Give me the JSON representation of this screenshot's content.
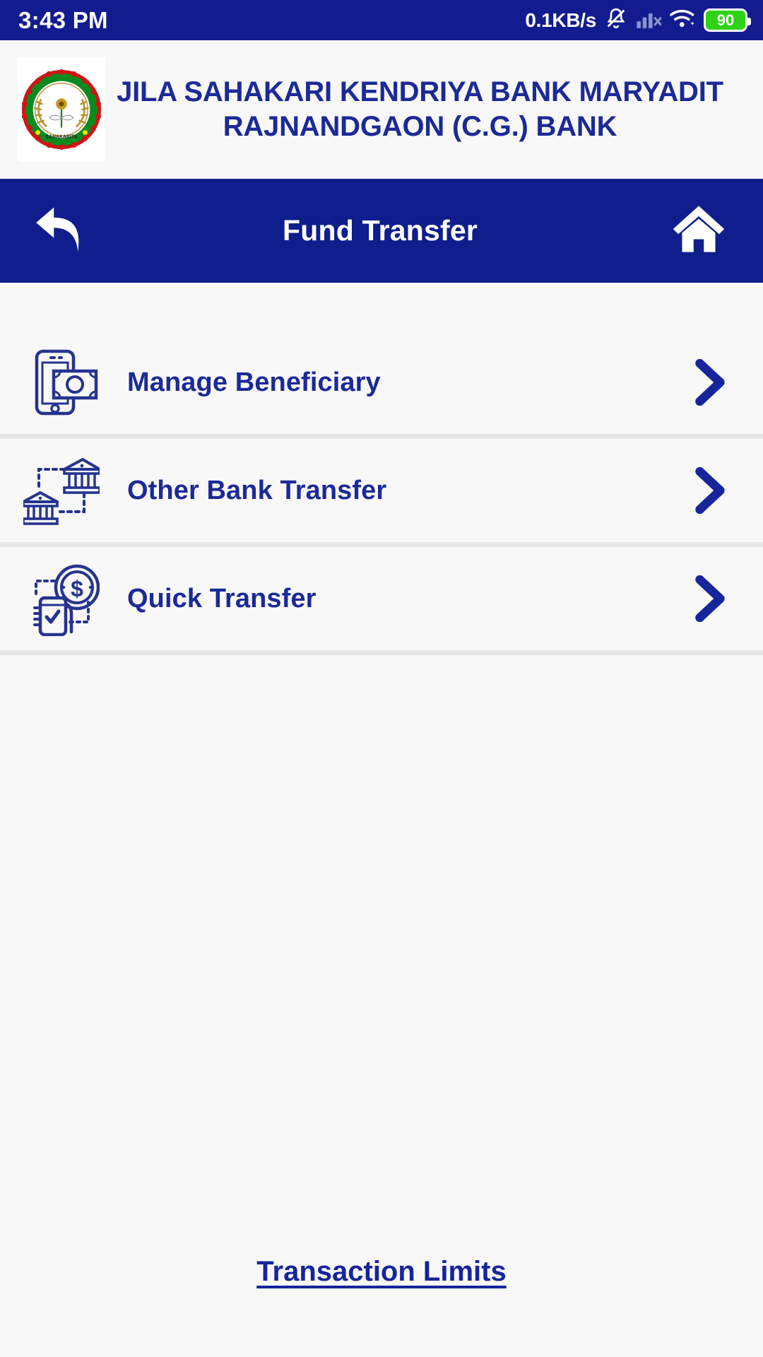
{
  "status_bar": {
    "time": "3:43 PM",
    "network_speed": "0.1KB/s",
    "battery_level": "90",
    "icons": [
      "bell-muted-icon",
      "cellular-signal-icon",
      "wifi-icon",
      "battery-icon"
    ],
    "background_color": "#131c8f"
  },
  "bank_header": {
    "title_line1": "JILA SAHAKARI KENDRIYA BANK MARYADIT",
    "title_line2": "RAJNANDGAON (C.G.) BANK",
    "logo_alt": "bank-seal-logo",
    "title_color": "#1b2a96"
  },
  "app_bar": {
    "title": "Fund Transfer",
    "back_icon": "back-arrow-icon",
    "home_icon": "home-icon",
    "background_color": "#0f1e8c",
    "text_color": "#ffffff"
  },
  "menu": {
    "items": [
      {
        "label": "Manage Beneficiary",
        "icon": "mobile-money-icon",
        "chevron": "chevron-right-icon"
      },
      {
        "label": "Other Bank Transfer",
        "icon": "bank-to-bank-icon",
        "chevron": "chevron-right-icon"
      },
      {
        "label": "Quick Transfer",
        "icon": "quick-pay-coin-icon",
        "chevron": "chevron-right-icon"
      }
    ],
    "item_color": "#1b2a96",
    "divider_color": "#e6e6e6"
  },
  "footer": {
    "link_label": "Transaction Limits",
    "link_color": "#16259a"
  }
}
